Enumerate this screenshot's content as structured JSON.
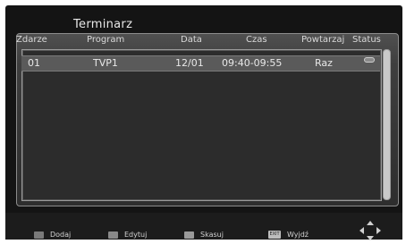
{
  "window": {
    "title": "Terminarz"
  },
  "table": {
    "columns": [
      "Zdarze",
      "Program",
      "Data",
      "Czas",
      "Powtarzaj",
      "Status"
    ],
    "rows": [
      {
        "event": "01",
        "program": "TVP1",
        "date": "12/01",
        "time": "09:40-09:55",
        "repeat": "Raz",
        "status_icon": "toggle-on-icon"
      }
    ]
  },
  "footer": {
    "buttons": [
      {
        "label": "Dodaj",
        "key_color": "#7a7a7a"
      },
      {
        "label": "Edytuj",
        "key_color": "#8a8a8a"
      },
      {
        "label": "Skasuj",
        "key_color": "#9a9a9a"
      },
      {
        "label": "Wyjdź",
        "key_label": "EXIT",
        "key_color": "#bdbdbd"
      }
    ],
    "nav_icon": "navigation-pad-icon"
  }
}
